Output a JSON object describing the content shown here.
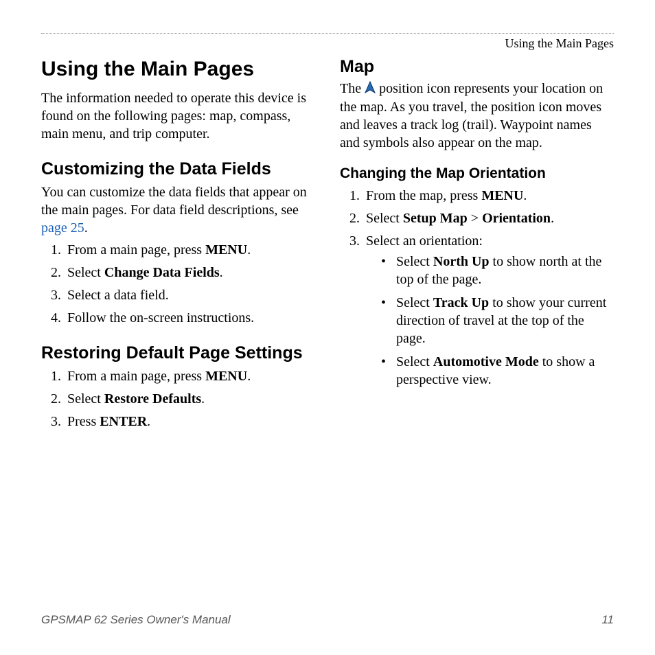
{
  "header": {
    "running": "Using the Main Pages"
  },
  "left": {
    "title": "Using the Main Pages",
    "intro": "The information needed to operate this device is found on the following pages: map, compass, main menu, and trip computer.",
    "customizing": {
      "heading": "Customizing the Data Fields",
      "p1a": "You can customize the data fields that appear on the main pages. For data field descriptions, see ",
      "link": "page 25",
      "p1b": ".",
      "steps": {
        "s1a": "From a main page, press ",
        "s1b": "MENU",
        "s1c": ".",
        "s2a": "Select ",
        "s2b": "Change Data Fields",
        "s2c": ".",
        "s3": "Select a data field.",
        "s4": "Follow the on-screen instructions."
      }
    },
    "restoring": {
      "heading": "Restoring Default Page Settings",
      "steps": {
        "s1a": "From a main page, press ",
        "s1b": "MENU",
        "s1c": ".",
        "s2a": "Select ",
        "s2b": "Restore Defaults",
        "s2c": ".",
        "s3a": "Press ",
        "s3b": "ENTER",
        "s3c": "."
      }
    }
  },
  "right": {
    "map_heading": "Map",
    "map_p1a": "The ",
    "map_p1b": " position icon represents your location on the map. As you travel, the position icon moves and leaves a track log (trail). Waypoint names and symbols also appear on the map.",
    "orient": {
      "heading": "Changing the Map Orientation",
      "s1a": "From the map, press ",
      "s1b": "MENU",
      "s1c": ".",
      "s2a": "Select ",
      "s2b": "Setup Map",
      "s2c": " > ",
      "s2d": "Orientation",
      "s2e": ".",
      "s3": "Select an orientation:",
      "b1a": "Select ",
      "b1b": "North Up",
      "b1c": " to show north at the top of the page.",
      "b2a": "Select ",
      "b2b": "Track Up",
      "b2c": " to show your current direction of travel at the top of the page.",
      "b3a": "Select ",
      "b3b": "Automotive Mode",
      "b3c": " to show a perspective view."
    }
  },
  "footer": {
    "manual": "GPSMAP 62 Series Owner's Manual",
    "page": "11"
  }
}
